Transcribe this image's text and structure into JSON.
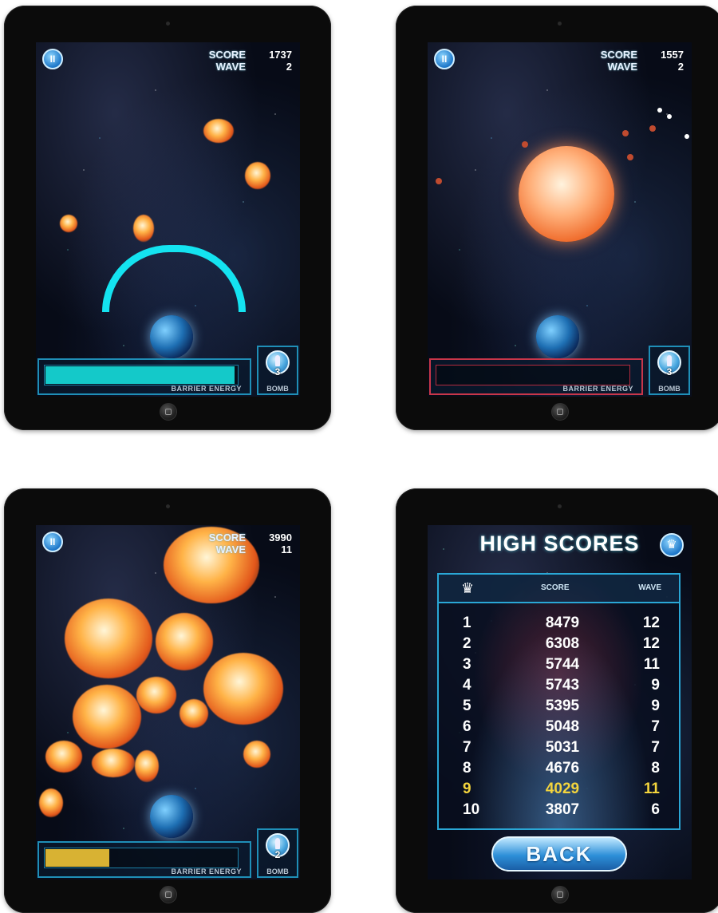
{
  "accent_colors": {
    "barrier": "#14e3f0",
    "energy_cyan": "#14c9c9",
    "energy_yellow": "#d8b233",
    "highlight": "#f3d43d",
    "danger": "#c9364a"
  },
  "screens": [
    {
      "score_label": "SCORE",
      "score": "1737",
      "wave_label": "WAVE",
      "wave": "2",
      "energy_label": "BARRIER ENERGY",
      "energy_level": 0.98,
      "bomb_count": "3",
      "bomb_label": "BOMB"
    },
    {
      "score_label": "SCORE",
      "score": "1557",
      "wave_label": "WAVE",
      "wave": "2",
      "energy_label": "BARRIER ENERGY",
      "energy_level": 0.0,
      "bomb_count": "3",
      "bomb_label": "BOMB"
    },
    {
      "score_label": "SCORE",
      "score": "3990",
      "wave_label": "WAVE",
      "wave": "11",
      "energy_label": "BARRIER ENERGY",
      "energy_level": 0.33,
      "bomb_count": "2",
      "bomb_label": "BOMB"
    }
  ],
  "high_scores": {
    "title": "HIGH SCORES",
    "col_score": "SCORE",
    "col_wave": "WAVE",
    "back_label": "BACK",
    "rows": [
      {
        "rank": "1",
        "score": "8479",
        "wave": "12"
      },
      {
        "rank": "2",
        "score": "6308",
        "wave": "12"
      },
      {
        "rank": "3",
        "score": "5744",
        "wave": "11"
      },
      {
        "rank": "4",
        "score": "5743",
        "wave": "9"
      },
      {
        "rank": "5",
        "score": "5395",
        "wave": "9"
      },
      {
        "rank": "6",
        "score": "5048",
        "wave": "7"
      },
      {
        "rank": "7",
        "score": "5031",
        "wave": "7"
      },
      {
        "rank": "8",
        "score": "4676",
        "wave": "8"
      },
      {
        "rank": "9",
        "score": "4029",
        "wave": "11"
      },
      {
        "rank": "10",
        "score": "3807",
        "wave": "6"
      }
    ],
    "highlighted_rank": "9"
  },
  "icons": {
    "pause": "pause-icon",
    "bomb": "bomb-icon",
    "crown": "crown-icon",
    "home": "home-button-icon"
  }
}
